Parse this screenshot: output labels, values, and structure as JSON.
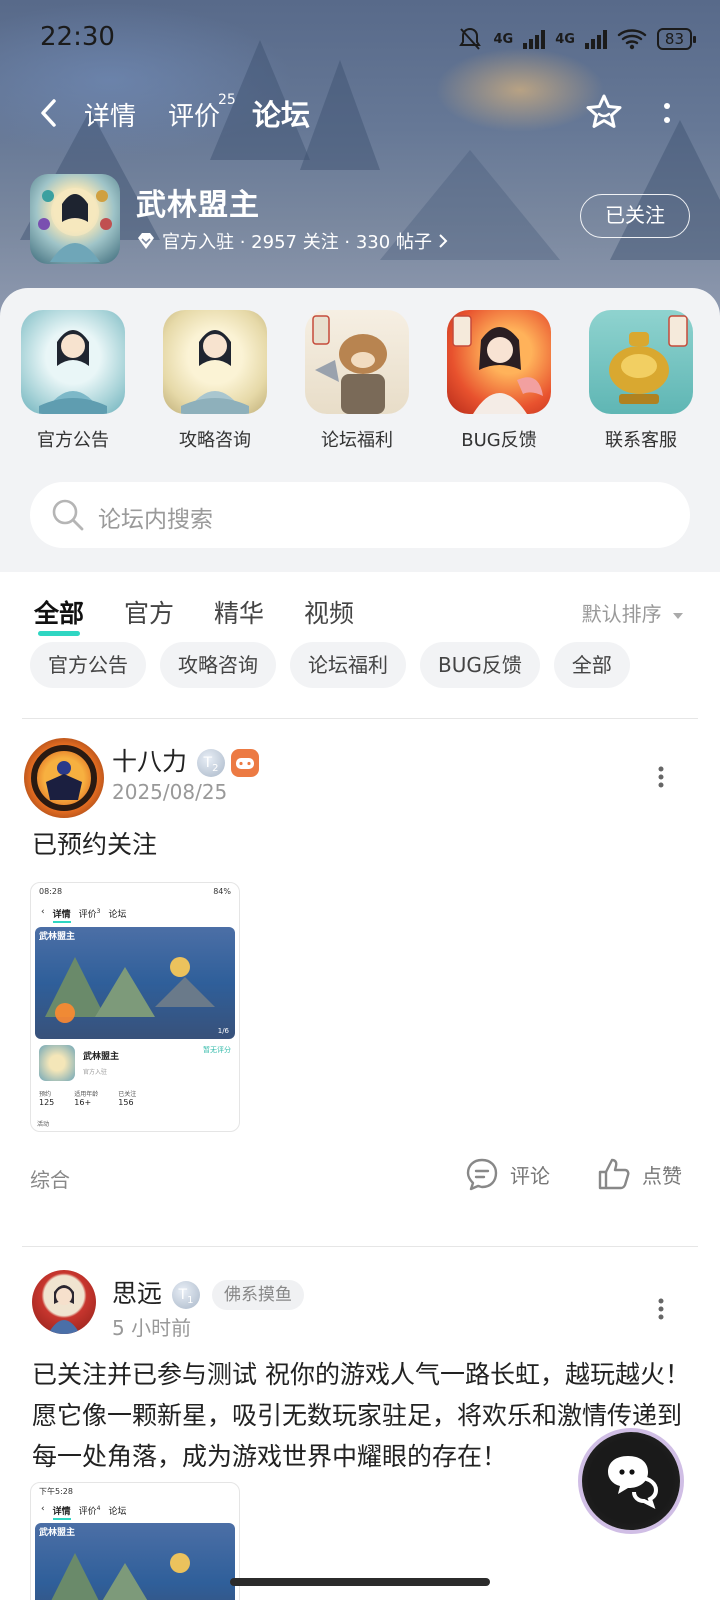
{
  "status_bar": {
    "time": "22:30",
    "network_1": "4G",
    "network_2": "4G",
    "battery": "83"
  },
  "nav": {
    "tabs": [
      {
        "label": "详情"
      },
      {
        "label": "评价",
        "badge": "25"
      },
      {
        "label": "论坛"
      }
    ]
  },
  "game": {
    "name": "武林盟主",
    "meta": "官方入驻 · 2957 关注 · 330 帖子",
    "follow_label": "已关注"
  },
  "categories": [
    {
      "label": "官方公告"
    },
    {
      "label": "攻略咨询"
    },
    {
      "label": "论坛福利"
    },
    {
      "label": "BUG反馈"
    },
    {
      "label": "联系客服"
    }
  ],
  "search": {
    "placeholder": "论坛内搜索"
  },
  "feed_tabs": [
    {
      "label": "全部"
    },
    {
      "label": "官方"
    },
    {
      "label": "精华"
    },
    {
      "label": "视频"
    }
  ],
  "sort_label": "默认排序",
  "chips": [
    {
      "label": "官方公告"
    },
    {
      "label": "攻略咨询"
    },
    {
      "label": "论坛福利"
    },
    {
      "label": "BUG反馈"
    },
    {
      "label": "全部"
    }
  ],
  "posts": [
    {
      "author": "十八力",
      "badge_level": "2",
      "date": "2025/08/25",
      "text": "已预约关注",
      "topic": "综合",
      "comment_label": "评论",
      "like_label": "点赞",
      "thumb": {
        "time": "08:28",
        "battery": "84%",
        "tab_1": "详情",
        "tab_2": "评价",
        "tab_2_badge": "3",
        "tab_3": "论坛",
        "logo": "武林盟主",
        "page": "1/6",
        "name": "武林盟主",
        "rating_link": "暂无评分",
        "meta": "官方入驻",
        "stats": [
          {
            "label": "预约",
            "value": "125"
          },
          {
            "label": "适用年龄",
            "value": "16+"
          },
          {
            "label": "已关注",
            "value": "156"
          }
        ],
        "footer": "活动"
      }
    },
    {
      "author": "思远",
      "badge_level": "1",
      "tag": "佛系摸鱼",
      "date": "5 小时前",
      "text": "已关注并已参与测试 祝你的游戏人气一路长虹，越玩越火！愿它像一颗新星，吸引无数玩家驻足，将欢乐和激情传递到每一处角落，成为游戏世界中耀眼的存在！",
      "thumb": {
        "time": "下午5:28",
        "tab_1": "详情",
        "tab_2": "评价",
        "tab_2_badge": "4",
        "tab_3": "论坛",
        "logo": "武林盟主"
      }
    }
  ]
}
